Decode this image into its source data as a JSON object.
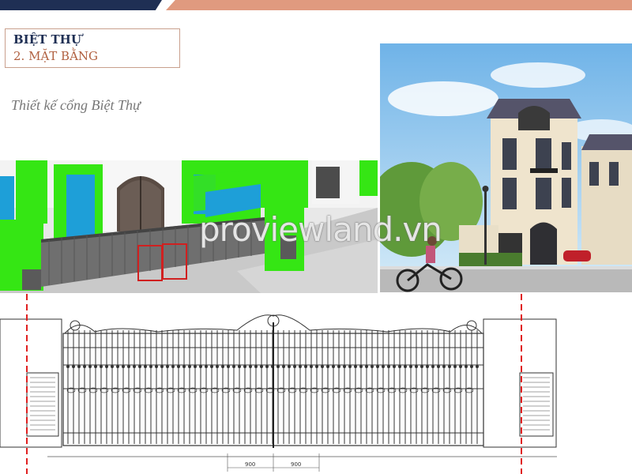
{
  "header": {
    "title": "BIỆT THỰ",
    "subtitle": "2. MẶT BẰNG"
  },
  "caption": "Thiết kế cổng Biệt Thự",
  "watermark": "proviewland.vn",
  "drawing": {
    "dimension_left": "900",
    "dimension_right": "900"
  },
  "colors": {
    "navy": "#1f2f54",
    "salmon": "#e09a7f",
    "render_green": "#35e614",
    "dashed_line": "#e02020"
  }
}
